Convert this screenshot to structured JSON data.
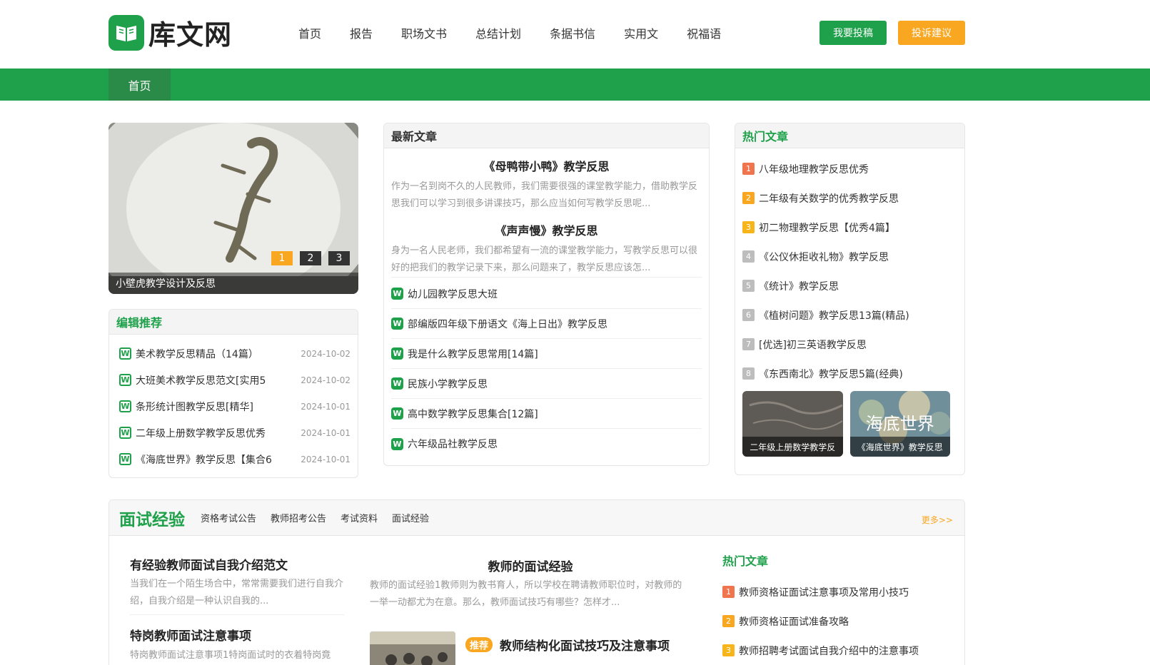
{
  "logo": {
    "text": "库文网"
  },
  "nav": {
    "items": [
      "首页",
      "报告",
      "职场文书",
      "总结计划",
      "条据书信",
      "实用文",
      "祝福语"
    ]
  },
  "header": {
    "submit_label": "我要投稿",
    "complaint_label": "投诉建议"
  },
  "breadcrumb": {
    "label": "首页"
  },
  "slider": {
    "caption": "小壁虎教学设计及反思",
    "dots": [
      "1",
      "2",
      "3"
    ]
  },
  "editor": {
    "title": "编辑推荐",
    "items": [
      {
        "title": "美术教学反思精品（14篇）",
        "date": "2024-10-02"
      },
      {
        "title": "大班美术教学反思范文[实用5",
        "date": "2024-10-02"
      },
      {
        "title": "条形统计图教学反思[精华]",
        "date": "2024-10-01"
      },
      {
        "title": "二年级上册数学教学反思优秀",
        "date": "2024-10-01"
      },
      {
        "title": "《海底世界》教学反思【集合6",
        "date": "2024-10-01"
      }
    ]
  },
  "latest": {
    "title": "最新文章",
    "featured": [
      {
        "title": "《母鸭带小鸭》教学反思",
        "summary": "作为一名到岗不久的人民教师，我们需要很强的课堂教学能力，借助教学反思我们可以学习到很多讲课技巧，那么应当如何写教学反思呢..."
      },
      {
        "title": "《声声慢》教学反思",
        "summary": "身为一名人民老师，我们都希望有一流的课堂教学能力，写教学反思可以很好的把我们的教学记录下来，那么问题来了，教学反思应该怎..."
      }
    ],
    "items": [
      "幼儿园教学反思大班",
      "部编版四年级下册语文《海上日出》教学反思",
      "我是什么教学反思常用[14篇]",
      "民族小学教学反思",
      "高中数学教学反思集合[12篇]",
      "六年级品社教学反思"
    ]
  },
  "hot": {
    "title": "热门文章",
    "items": [
      "八年级地理教学反思优秀",
      "二年级有关数学的优秀教学反思",
      "初二物理教学反思【优秀4篇】",
      "《公仪休拒收礼物》教学反思",
      "《统计》教学反思",
      "《植树问题》教学反思13篇(精品)",
      "[优选]初三英语教学反思",
      "《东西南北》教学反思5篇(经典)"
    ],
    "numbers": [
      "1",
      "2",
      "3",
      "4",
      "5",
      "6",
      "7",
      "8"
    ],
    "thumbs": [
      {
        "caption": "二年级上册数学教学反"
      },
      {
        "caption": "《海底世界》教学反思",
        "overlay": "海底世界"
      }
    ]
  },
  "interview": {
    "title": "面试经验",
    "tabs": [
      "资格考试公告",
      "教师招考公告",
      "考试资料",
      "面试经验"
    ],
    "more": "更多>>",
    "left": [
      {
        "title": "有经验教师面试自我介绍范文",
        "summary": "当我们在一个陌生场合中，常常需要我们进行自我介绍，自我介绍是一种认识自我的..."
      },
      {
        "title": "特岗教师面试注意事项",
        "summary": "特岗教师面试注意事项1特岗面试时的衣着特岗竟"
      }
    ],
    "center": {
      "title": "教师的面试经验",
      "summary": "教师的面试经验1教师则为教书育人，所以学校在聘请教师职位时，对教师的一举一动都尤为在意。那么，教师面试技巧有哪些？怎样才..."
    },
    "recommend": {
      "badge": "推荐",
      "title": "教师结构化面试技巧及注意事项"
    },
    "hot_title": "热门文章",
    "hot_items": [
      "教师资格证面试注意事项及常用小技巧",
      "教师资格证面试准备攻略",
      "教师招聘考试面试自我介绍中的注意事项"
    ]
  }
}
